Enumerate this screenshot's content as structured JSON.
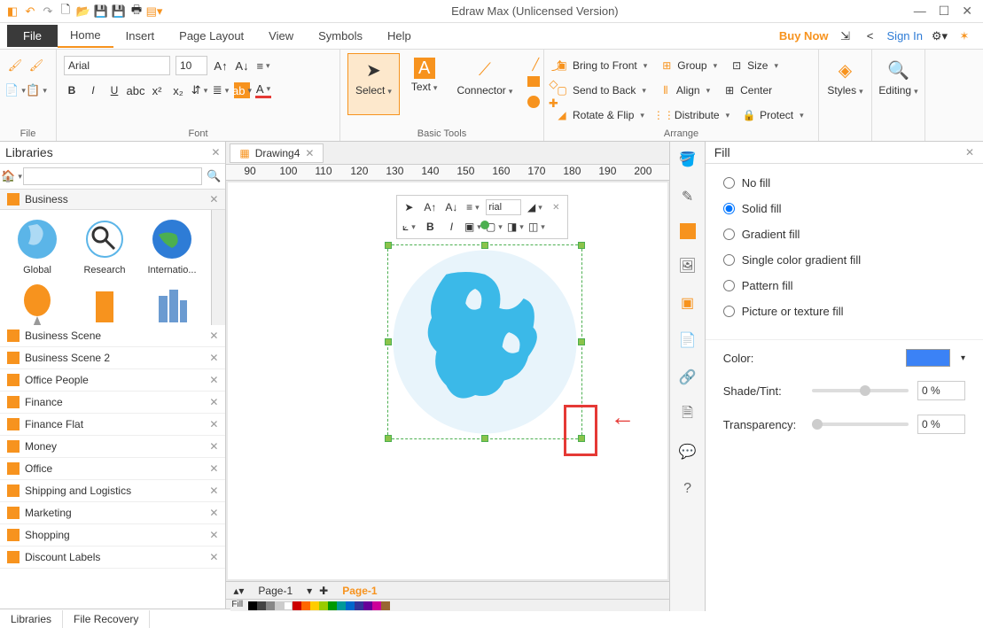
{
  "app": {
    "title": "Edraw Max (Unlicensed Version)"
  },
  "menu": {
    "file": "File",
    "tabs": [
      "Home",
      "Insert",
      "Page Layout",
      "View",
      "Symbols",
      "Help"
    ],
    "active": "Home",
    "buy": "Buy Now",
    "signin": "Sign In"
  },
  "ribbon": {
    "file_group": "File",
    "font_group": "Font",
    "font_name": "Arial",
    "font_size": "10",
    "basic_tools": "Basic Tools",
    "select": "Select",
    "text": "Text",
    "connector": "Connector",
    "arrange_group": "Arrange",
    "bring_front": "Bring to Front",
    "send_back": "Send to Back",
    "rotate_flip": "Rotate & Flip",
    "group": "Group",
    "align": "Align",
    "distribute": "Distribute",
    "size": "Size",
    "center": "Center",
    "protect": "Protect",
    "styles": "Styles",
    "editing": "Editing"
  },
  "libraries": {
    "title": "Libraries",
    "search_placeholder": "",
    "open_category": "Business",
    "shapes": [
      {
        "label": "Global"
      },
      {
        "label": "Research"
      },
      {
        "label": "Internatio..."
      }
    ],
    "categories": [
      "Business Scene",
      "Business Scene 2",
      "Office People",
      "Finance",
      "Finance Flat",
      "Money",
      "Office",
      "Shipping and Logistics",
      "Marketing",
      "Shopping",
      "Discount Labels"
    ],
    "bottom_tabs": [
      "Libraries",
      "File Recovery"
    ]
  },
  "doc": {
    "tab": "Drawing4",
    "ruler": [
      "90",
      "100",
      "110",
      "120",
      "130",
      "140",
      "150",
      "160",
      "170",
      "180",
      "190",
      "200"
    ],
    "mini_font": "rial",
    "page_label": "Page-1",
    "page_active": "Page-1",
    "fill_label": "Fill"
  },
  "fill": {
    "title": "Fill",
    "options": [
      {
        "label": "No fill",
        "checked": false
      },
      {
        "label": "Solid fill",
        "checked": true
      },
      {
        "label": "Gradient fill",
        "checked": false
      },
      {
        "label": "Single color gradient fill",
        "checked": false
      },
      {
        "label": "Pattern fill",
        "checked": false
      },
      {
        "label": "Picture or texture fill",
        "checked": false
      }
    ],
    "color_label": "Color:",
    "color_value": "#3b82f6",
    "shade_label": "Shade/Tint:",
    "shade_value": "0 %",
    "transparency_label": "Transparency:",
    "transparency_value": "0 %"
  }
}
